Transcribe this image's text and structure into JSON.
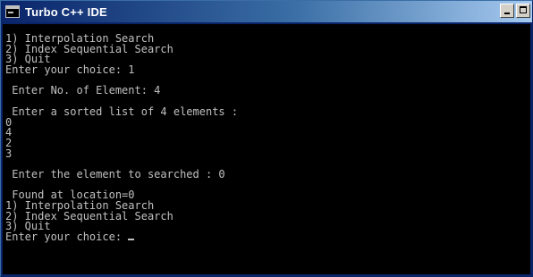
{
  "window": {
    "title": "Turbo C++ IDE",
    "icon": "console-icon",
    "controls": [
      "minimize-icon",
      "maximize-icon"
    ]
  },
  "console": {
    "lines": [
      "1) Interpolation Search",
      "2) Index Sequential Search",
      "3) Quit",
      "Enter your choice: 1",
      "",
      " Enter No. of Element: 4",
      "",
      " Enter a sorted list of 4 elements :",
      "0",
      "4",
      "2",
      "3",
      "",
      " Enter the element to searched : 0",
      "",
      " Found at location=0",
      "1) Interpolation Search",
      "2) Index Sequential Search",
      "3) Quit",
      "Enter your choice: "
    ],
    "text_color": "#c0c0c0",
    "background_color": "#000000"
  }
}
